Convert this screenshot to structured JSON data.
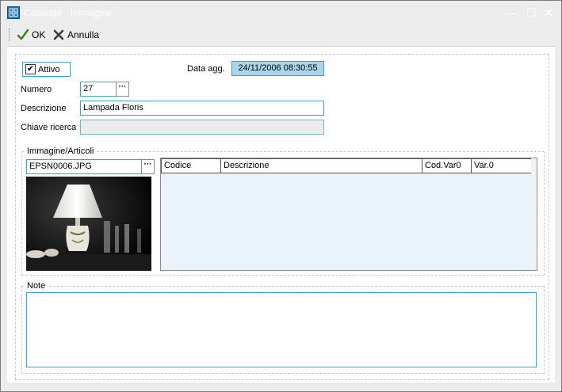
{
  "window": {
    "title": "Catalogo - Immagine",
    "controls": {
      "minimize": "—",
      "maximize": "☐",
      "close": "✕"
    }
  },
  "toolbar": {
    "ok_label": "OK",
    "cancel_label": "Annulla"
  },
  "form": {
    "active": {
      "label": "Attivo",
      "checked": true,
      "check_glyph": "✔"
    },
    "updated": {
      "label": "Data agg.",
      "value": "24/11/2006 08:30:55"
    },
    "number": {
      "label": "Numero",
      "value": "27",
      "button": "···"
    },
    "description": {
      "label": "Descrizione",
      "value": "Lampada Floris"
    },
    "search_key": {
      "label": "Chiave ricerca",
      "value": ""
    }
  },
  "images_group": {
    "title": "Immagine/Articoli",
    "file": {
      "value": "EPSN0006.JPG",
      "button": "···"
    },
    "table": {
      "columns": [
        "Codice",
        "Descrizione",
        "Cod.Var0",
        "Var.0"
      ],
      "rows": []
    }
  },
  "notes_group": {
    "title": "Note",
    "value": ""
  },
  "colors": {
    "accent_border": "#32a6c8",
    "date_field_bg": "#a9d6ea",
    "table_bg": "#eaf3fa",
    "chrome_bg": "#ececec"
  },
  "icons": {
    "app": "grid-app-icon",
    "ok": "checkmark-icon",
    "cancel": "x-icon"
  }
}
